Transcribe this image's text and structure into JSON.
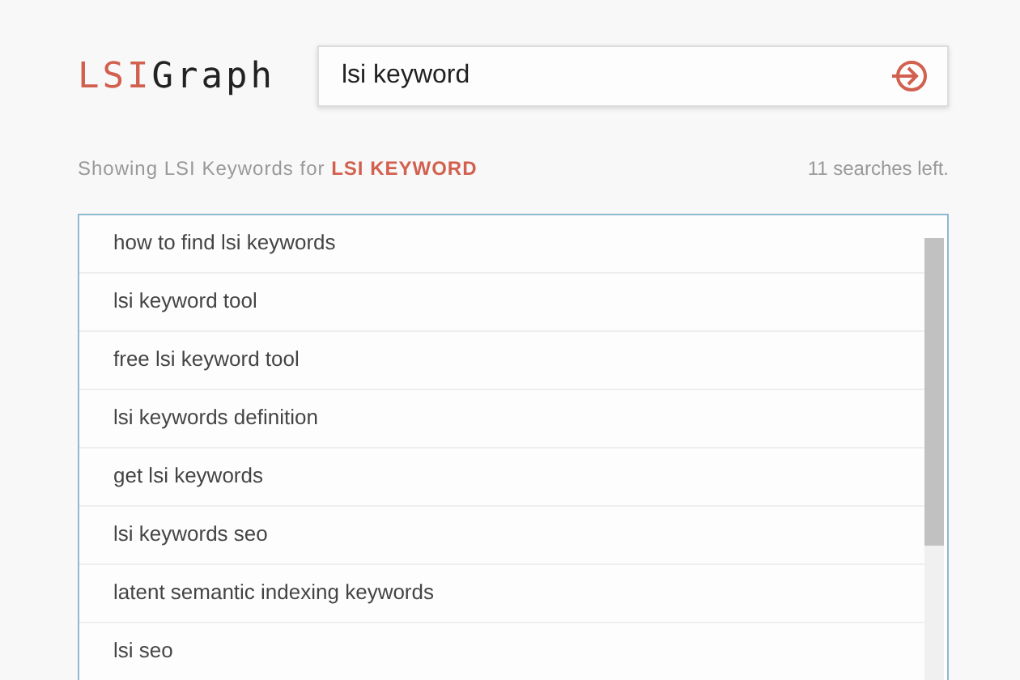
{
  "logo": {
    "accent": "LSI",
    "rest": "Graph"
  },
  "search": {
    "value": "lsi keyword"
  },
  "summary": {
    "prefix": "Showing LSI Keywords for",
    "term": "LSI KEYWORD",
    "remaining": "11 searches left."
  },
  "results": [
    {
      "text": "how to find lsi keywords"
    },
    {
      "text": "lsi keyword tool"
    },
    {
      "text": "free lsi keyword tool"
    },
    {
      "text": "lsi keywords definition"
    },
    {
      "text": "get lsi keywords"
    },
    {
      "text": "lsi keywords seo"
    },
    {
      "text": "latent semantic indexing keywords"
    },
    {
      "text": "lsi seo"
    }
  ]
}
